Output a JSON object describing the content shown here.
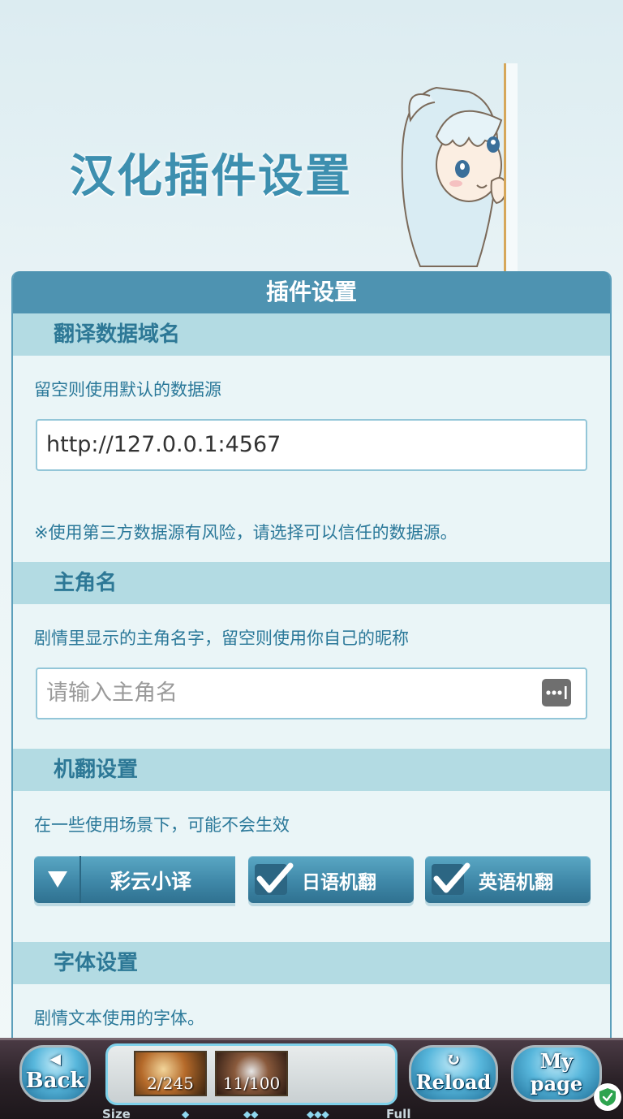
{
  "banner": {
    "title": "汉化插件设置"
  },
  "panel": {
    "title": "插件设置"
  },
  "sections": {
    "domain": {
      "heading": "翻译数据域名",
      "description": "留空则使用默认的数据源",
      "input_value": "http://127.0.0.1:4567",
      "warning": "※使用第三方数据源有风险，请选择可以信任的数据源。"
    },
    "protagonist": {
      "heading": "主角名",
      "description": "剧情里显示的主角名字，留空则使用你自己的昵称",
      "input_placeholder": "请输入主角名"
    },
    "machine_translation": {
      "heading": "机翻设置",
      "description": "在一些使用场景下，可能不会生效",
      "select_value": "彩云小译",
      "japanese_label": "日语机翻",
      "japanese_checked": true,
      "english_label": "英语机翻",
      "english_checked": true
    },
    "font": {
      "heading": "字体设置",
      "description": "剧情文本使用的字体。"
    }
  },
  "gamebar": {
    "back_label": "Back",
    "reload_label": "Reload",
    "mypage_line1": "My",
    "mypage_line2": "page",
    "ap": "2/245",
    "bp": "11/100",
    "size_label": "Size",
    "full_label": "Full"
  },
  "colors": {
    "accent": "#4e93b1",
    "section_bg": "#b3dbe3",
    "text_blue": "#2a7899"
  },
  "icons": {
    "dropdown": "triangle-down-icon",
    "checkbox": "checkmark-icon",
    "password_manager": "password-dots-icon",
    "security": "shield-check-icon"
  }
}
